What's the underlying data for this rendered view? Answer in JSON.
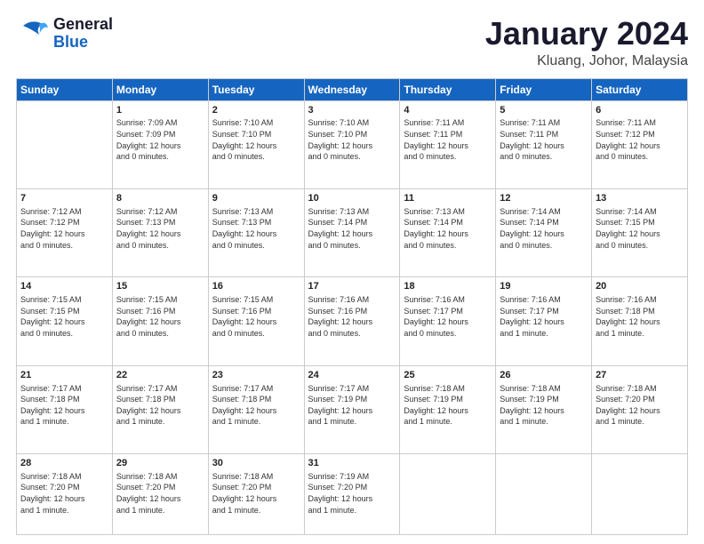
{
  "header": {
    "logo_general": "General",
    "logo_blue": "Blue",
    "month": "January 2024",
    "location": "Kluang, Johor, Malaysia"
  },
  "weekdays": [
    "Sunday",
    "Monday",
    "Tuesday",
    "Wednesday",
    "Thursday",
    "Friday",
    "Saturday"
  ],
  "weeks": [
    [
      {
        "day": "",
        "info": ""
      },
      {
        "day": "1",
        "info": "Sunrise: 7:09 AM\nSunset: 7:09 PM\nDaylight: 12 hours\nand 0 minutes."
      },
      {
        "day": "2",
        "info": "Sunrise: 7:10 AM\nSunset: 7:10 PM\nDaylight: 12 hours\nand 0 minutes."
      },
      {
        "day": "3",
        "info": "Sunrise: 7:10 AM\nSunset: 7:10 PM\nDaylight: 12 hours\nand 0 minutes."
      },
      {
        "day": "4",
        "info": "Sunrise: 7:11 AM\nSunset: 7:11 PM\nDaylight: 12 hours\nand 0 minutes."
      },
      {
        "day": "5",
        "info": "Sunrise: 7:11 AM\nSunset: 7:11 PM\nDaylight: 12 hours\nand 0 minutes."
      },
      {
        "day": "6",
        "info": "Sunrise: 7:11 AM\nSunset: 7:12 PM\nDaylight: 12 hours\nand 0 minutes."
      }
    ],
    [
      {
        "day": "7",
        "info": "Sunrise: 7:12 AM\nSunset: 7:12 PM\nDaylight: 12 hours\nand 0 minutes."
      },
      {
        "day": "8",
        "info": "Sunrise: 7:12 AM\nSunset: 7:13 PM\nDaylight: 12 hours\nand 0 minutes."
      },
      {
        "day": "9",
        "info": "Sunrise: 7:13 AM\nSunset: 7:13 PM\nDaylight: 12 hours\nand 0 minutes."
      },
      {
        "day": "10",
        "info": "Sunrise: 7:13 AM\nSunset: 7:14 PM\nDaylight: 12 hours\nand 0 minutes."
      },
      {
        "day": "11",
        "info": "Sunrise: 7:13 AM\nSunset: 7:14 PM\nDaylight: 12 hours\nand 0 minutes."
      },
      {
        "day": "12",
        "info": "Sunrise: 7:14 AM\nSunset: 7:14 PM\nDaylight: 12 hours\nand 0 minutes."
      },
      {
        "day": "13",
        "info": "Sunrise: 7:14 AM\nSunset: 7:15 PM\nDaylight: 12 hours\nand 0 minutes."
      }
    ],
    [
      {
        "day": "14",
        "info": "Sunrise: 7:15 AM\nSunset: 7:15 PM\nDaylight: 12 hours\nand 0 minutes."
      },
      {
        "day": "15",
        "info": "Sunrise: 7:15 AM\nSunset: 7:16 PM\nDaylight: 12 hours\nand 0 minutes."
      },
      {
        "day": "16",
        "info": "Sunrise: 7:15 AM\nSunset: 7:16 PM\nDaylight: 12 hours\nand 0 minutes."
      },
      {
        "day": "17",
        "info": "Sunrise: 7:16 AM\nSunset: 7:16 PM\nDaylight: 12 hours\nand 0 minutes."
      },
      {
        "day": "18",
        "info": "Sunrise: 7:16 AM\nSunset: 7:17 PM\nDaylight: 12 hours\nand 0 minutes."
      },
      {
        "day": "19",
        "info": "Sunrise: 7:16 AM\nSunset: 7:17 PM\nDaylight: 12 hours\nand 1 minute."
      },
      {
        "day": "20",
        "info": "Sunrise: 7:16 AM\nSunset: 7:18 PM\nDaylight: 12 hours\nand 1 minute."
      }
    ],
    [
      {
        "day": "21",
        "info": "Sunrise: 7:17 AM\nSunset: 7:18 PM\nDaylight: 12 hours\nand 1 minute."
      },
      {
        "day": "22",
        "info": "Sunrise: 7:17 AM\nSunset: 7:18 PM\nDaylight: 12 hours\nand 1 minute."
      },
      {
        "day": "23",
        "info": "Sunrise: 7:17 AM\nSunset: 7:18 PM\nDaylight: 12 hours\nand 1 minute."
      },
      {
        "day": "24",
        "info": "Sunrise: 7:17 AM\nSunset: 7:19 PM\nDaylight: 12 hours\nand 1 minute."
      },
      {
        "day": "25",
        "info": "Sunrise: 7:18 AM\nSunset: 7:19 PM\nDaylight: 12 hours\nand 1 minute."
      },
      {
        "day": "26",
        "info": "Sunrise: 7:18 AM\nSunset: 7:19 PM\nDaylight: 12 hours\nand 1 minute."
      },
      {
        "day": "27",
        "info": "Sunrise: 7:18 AM\nSunset: 7:20 PM\nDaylight: 12 hours\nand 1 minute."
      }
    ],
    [
      {
        "day": "28",
        "info": "Sunrise: 7:18 AM\nSunset: 7:20 PM\nDaylight: 12 hours\nand 1 minute."
      },
      {
        "day": "29",
        "info": "Sunrise: 7:18 AM\nSunset: 7:20 PM\nDaylight: 12 hours\nand 1 minute."
      },
      {
        "day": "30",
        "info": "Sunrise: 7:18 AM\nSunset: 7:20 PM\nDaylight: 12 hours\nand 1 minute."
      },
      {
        "day": "31",
        "info": "Sunrise: 7:19 AM\nSunset: 7:20 PM\nDaylight: 12 hours\nand 1 minute."
      },
      {
        "day": "",
        "info": ""
      },
      {
        "day": "",
        "info": ""
      },
      {
        "day": "",
        "info": ""
      }
    ]
  ]
}
